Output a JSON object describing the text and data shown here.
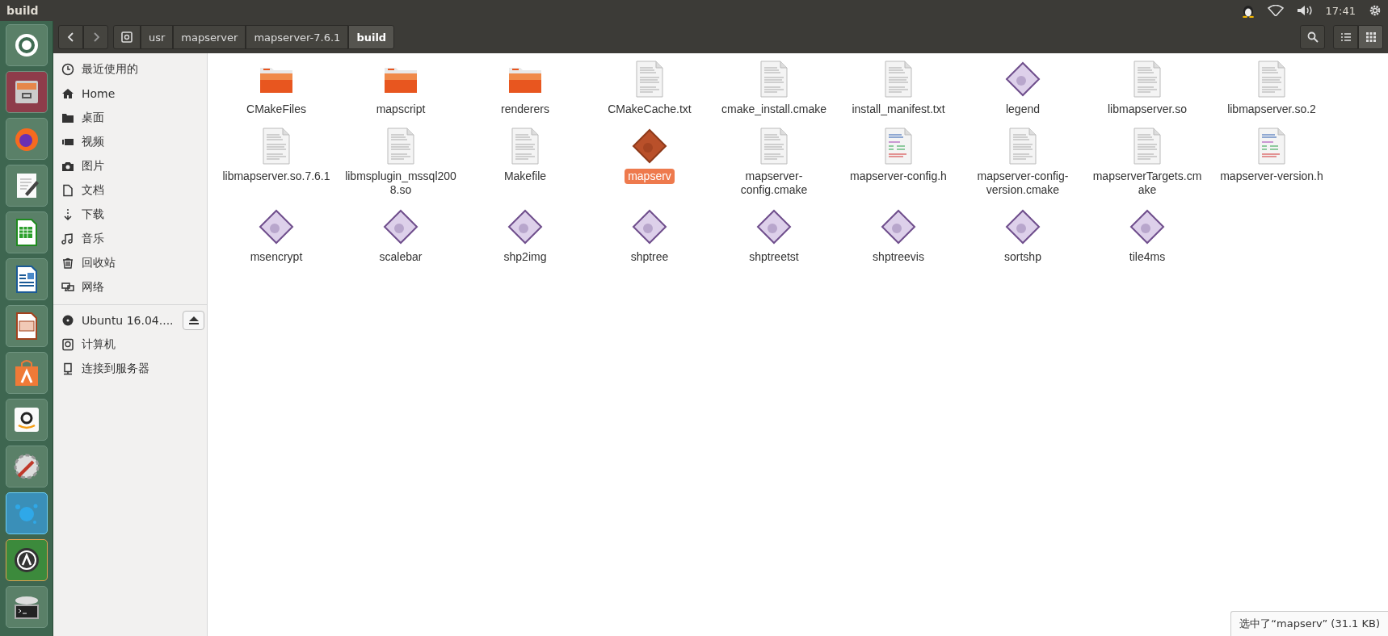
{
  "top_panel": {
    "title": "build",
    "clock": "17:41"
  },
  "toolbar": {
    "path": [
      {
        "label": "usr",
        "selected": false
      },
      {
        "label": "mapserver",
        "selected": false
      },
      {
        "label": "mapserver-7.6.1",
        "selected": false
      },
      {
        "label": "build",
        "selected": true
      }
    ],
    "views": [
      {
        "kind": "list",
        "selected": false
      },
      {
        "kind": "grid",
        "selected": true
      }
    ]
  },
  "sidebar": {
    "items": [
      {
        "kind": "recent",
        "label": "最近使用的"
      },
      {
        "kind": "home",
        "label": "Home"
      },
      {
        "kind": "folder",
        "label": "桌面"
      },
      {
        "kind": "video",
        "label": "视频"
      },
      {
        "kind": "camera",
        "label": "图片"
      },
      {
        "kind": "document",
        "label": "文档"
      },
      {
        "kind": "download",
        "label": "下载"
      },
      {
        "kind": "music",
        "label": "音乐"
      },
      {
        "kind": "trash",
        "label": "回收站"
      },
      {
        "kind": "network",
        "label": "网络"
      },
      {
        "kind": "disc",
        "label": "Ubuntu 16.04....",
        "eject": true,
        "section_start": true
      },
      {
        "kind": "computer",
        "label": "计算机"
      },
      {
        "kind": "server",
        "label": "连接到服务器"
      }
    ]
  },
  "files": [
    {
      "kind": "folder",
      "name": "CMakeFiles",
      "selected": false
    },
    {
      "kind": "folder",
      "name": "mapscript",
      "selected": false
    },
    {
      "kind": "folder",
      "name": "renderers",
      "selected": false
    },
    {
      "kind": "text",
      "name": "CMakeCache.txt",
      "selected": false
    },
    {
      "kind": "text",
      "name": "cmake_install.cmake",
      "selected": false
    },
    {
      "kind": "text",
      "name": "install_manifest.txt",
      "selected": false
    },
    {
      "kind": "executable",
      "name": "legend",
      "selected": false
    },
    {
      "kind": "text",
      "name": "libmapserver.so",
      "selected": false
    },
    {
      "kind": "text",
      "name": "libmapserver.so.2",
      "selected": false
    },
    {
      "kind": "text",
      "name": "libmapserver.so.7.6.1",
      "selected": false
    },
    {
      "kind": "text",
      "name": "libmsplugin_mssql2008.so",
      "selected": false
    },
    {
      "kind": "text",
      "name": "Makefile",
      "selected": false
    },
    {
      "kind": "executable",
      "name": "mapserv",
      "selected": true
    },
    {
      "kind": "text",
      "name": "mapserver-config.cmake",
      "selected": false
    },
    {
      "kind": "code",
      "name": "mapserver-config.h",
      "selected": false
    },
    {
      "kind": "text",
      "name": "mapserver-config-version.cmake",
      "selected": false
    },
    {
      "kind": "text",
      "name": "mapserverTargets.cmake",
      "selected": false
    },
    {
      "kind": "code",
      "name": "mapserver-version.h",
      "selected": false
    },
    {
      "kind": "executable",
      "name": "msencrypt",
      "selected": false
    },
    {
      "kind": "executable",
      "name": "scalebar",
      "selected": false
    },
    {
      "kind": "executable",
      "name": "shp2img",
      "selected": false
    },
    {
      "kind": "executable",
      "name": "shptree",
      "selected": false
    },
    {
      "kind": "executable",
      "name": "shptreetst",
      "selected": false
    },
    {
      "kind": "executable",
      "name": "shptreevis",
      "selected": false
    },
    {
      "kind": "executable",
      "name": "sortshp",
      "selected": false
    },
    {
      "kind": "executable",
      "name": "tile4ms",
      "selected": false
    }
  ],
  "status": "选中了“mapserv” (31.1 KB)"
}
